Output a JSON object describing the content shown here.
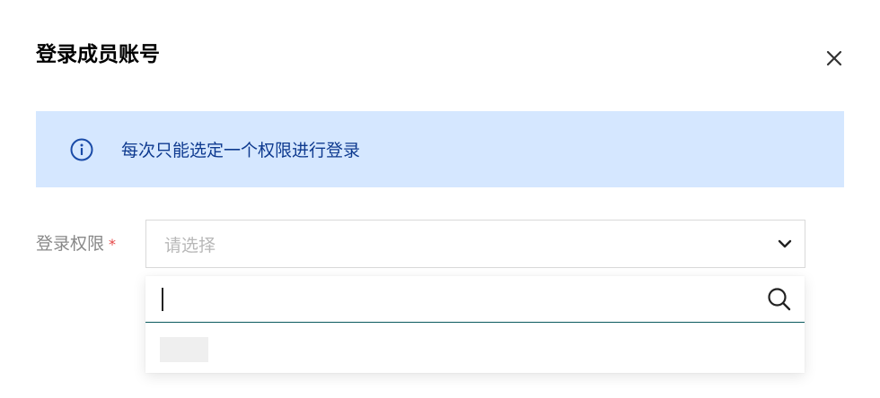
{
  "dialog": {
    "title": "登录成员账号",
    "close_icon": "close-icon"
  },
  "banner": {
    "icon": "info-icon",
    "text": "每次只能选定一个权限进行登录",
    "background": "#d5e7ff",
    "text_color": "#0e3a8f"
  },
  "form": {
    "label": "登录权限",
    "required_mark": "*",
    "select_placeholder": "请选择",
    "chevron_icon": "chevron-down-icon"
  },
  "dropdown": {
    "search_value": "",
    "search_icon": "search-icon",
    "options": [
      {
        "label": ""
      }
    ]
  }
}
